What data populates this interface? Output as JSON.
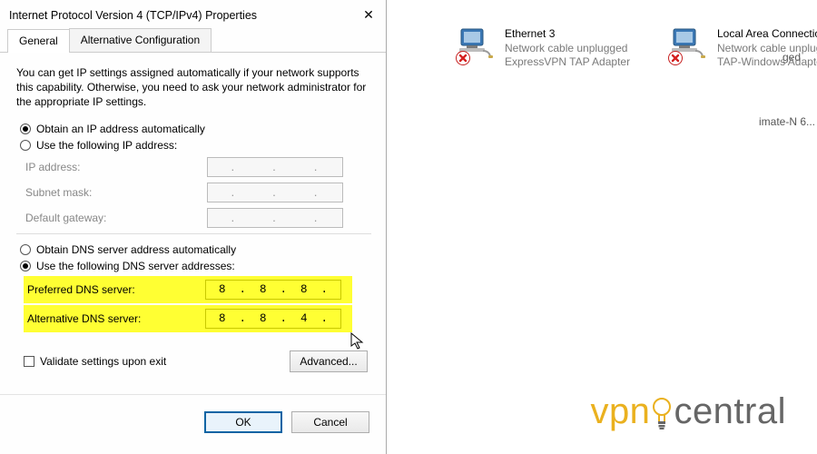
{
  "dialog": {
    "title": "Internet Protocol Version 4 (TCP/IPv4) Properties",
    "tabs": {
      "general": "General",
      "alt": "Alternative Configuration"
    },
    "intro": "You can get IP settings assigned automatically if your network supports this capability. Otherwise, you need to ask your network administrator for the appropriate IP settings.",
    "ip": {
      "auto_label": "Obtain an IP address automatically",
      "manual_label": "Use the following IP address:",
      "auto_selected": true,
      "fields": {
        "ip_label": "IP address:",
        "mask_label": "Subnet mask:",
        "gw_label": "Default gateway:",
        "ip_value": ".       .       .",
        "mask_value": ".       .       .",
        "gw_value": ".       .       ."
      }
    },
    "dns": {
      "auto_label": "Obtain DNS server address automatically",
      "manual_label": "Use the following DNS server addresses:",
      "manual_selected": true,
      "pref_label": "Preferred DNS server:",
      "alt_label": "Alternative DNS server:",
      "pref_value": "8  .  8  .  8  .  8",
      "alt_value": "8  .  8  .  4  .  4"
    },
    "validate_label": "Validate settings upon exit",
    "advanced_label": "Advanced...",
    "ok_label": "OK",
    "cancel_label": "Cancel"
  },
  "bg_fragments": {
    "ged": "ged",
    "imate": "imate-N 6..."
  },
  "adapters": {
    "eth3": {
      "name": "Ethernet 3",
      "line2": "Network cable unplugged",
      "line3": "ExpressVPN TAP Adapter"
    },
    "lac": {
      "name": "Local Area Connectio",
      "line2": "Network cable unplug",
      "line3": "TAP-Windows Adapte"
    }
  },
  "watermark": {
    "left": "vpn",
    "right": "central"
  }
}
